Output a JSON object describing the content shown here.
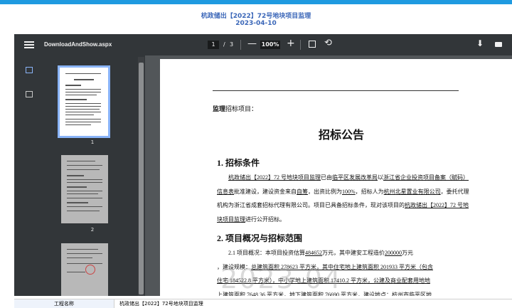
{
  "header": {
    "title": "杭政储出【2022】72号地块项目监理",
    "date": "2023-04-10"
  },
  "toolbar": {
    "filename": "DownloadAndShow.aspx",
    "current_page": "1",
    "page_sep": "/",
    "total_pages": "3",
    "zoom": "100%",
    "icons": [
      "menu-icon",
      "zoom-out-icon",
      "zoom-in-icon",
      "fit-page-icon",
      "rotate-icon",
      "download-icon",
      "print-icon"
    ]
  },
  "sidebar": {
    "icons": [
      "thumbnail-view-icon",
      "outline-view-icon"
    ],
    "thumbnails": [
      {
        "label": "1"
      },
      {
        "label": "2"
      }
    ]
  },
  "document": {
    "label_bold": "监理",
    "label_rest": "招标项目：",
    "title": "招标公告",
    "section1_title": "1.   招标条件",
    "section1_text_a": "杭政储出【2022】72 号地块项目监理",
    "section1_text_b": "已由",
    "section1_text_c": "临平区发展改革局",
    "section1_text_d": "以",
    "section1_text_e": "浙江省企业投资项目",
    "section1_text_f": "备案（赋码）信息表",
    "section1_text_g": "批准建设，建设资金来自",
    "section1_text_h": "自筹",
    "section1_text_i": "，出资比例为",
    "section1_text_j": "100%",
    "section1_text_k": "，招标人为",
    "section1_text_l": "杭州北星置",
    "section1_text_m": "业有限公司",
    "section1_text_n": "，委托代理机构为浙江省成套招标代理有限公司。项目已具备招标条件，现对该",
    "section1_text_o": "项目的",
    "section1_text_p": "杭政储出【2022】72 号地块项目监理",
    "section1_text_q": "进行公开招标。",
    "section2_title": "2.   项目概况与招标范围",
    "section2_line1_a": "2.1   项目概况：本项目投资估算",
    "section2_line1_b": "484652",
    "section2_line1_c": "万元，其中建安工程造价",
    "section2_line1_d": "200000",
    "section2_line1_e": "万元",
    "section2_line2_a": "，建设规模：",
    "section2_line2_b": "总建筑面积 278623 平方米，其中住宅地上建筑面积 201933 平方米（包含",
    "section2_line3": "住宅 184522.8 平方米），中小学地上建筑面积 17410.2 平方米，公建及商业配套用地地",
    "section2_line4": "上建筑面积 7648.36 平方米，地下建筑面积 76690 平方米，建设地点：杭州市临平区地"
  },
  "watermark": "2023 04",
  "info_row": {
    "key": "工程名称",
    "value": "杭政储出【2022】72号地块项目监理"
  }
}
